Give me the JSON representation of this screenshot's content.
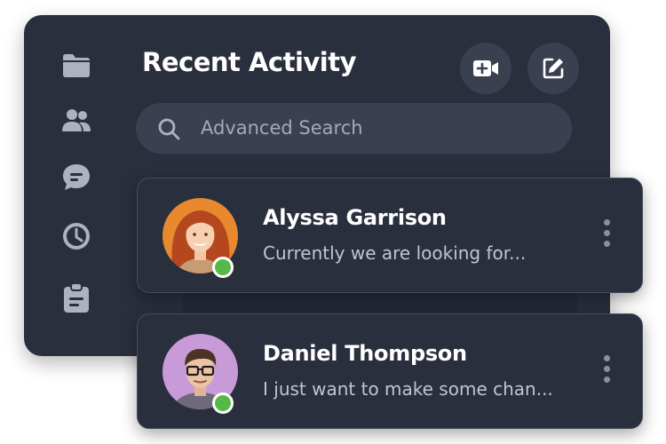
{
  "header": {
    "title": "Recent Activity",
    "video_button_icon": "video-add-icon",
    "compose_button_icon": "edit-icon"
  },
  "sidebar": {
    "items": [
      {
        "icon": "folder-icon"
      },
      {
        "icon": "users-icon"
      },
      {
        "icon": "chat-icon"
      },
      {
        "icon": "clock-icon"
      },
      {
        "icon": "clipboard-icon"
      }
    ]
  },
  "search": {
    "placeholder": "Advanced Search"
  },
  "conversations": [
    {
      "name": "Alyssa Garrison",
      "preview": "Currently we are looking for...",
      "status": "online",
      "avatar_bg": "#e8892e"
    },
    {
      "name": "Daniel Thompson",
      "preview": "I just want to make some chan...",
      "status": "online",
      "avatar_bg": "#c89bd8"
    }
  ],
  "colors": {
    "panel": "#2a2f3e",
    "surface": "#3a4050",
    "online": "#55b947",
    "icon": "#aeb2be"
  }
}
